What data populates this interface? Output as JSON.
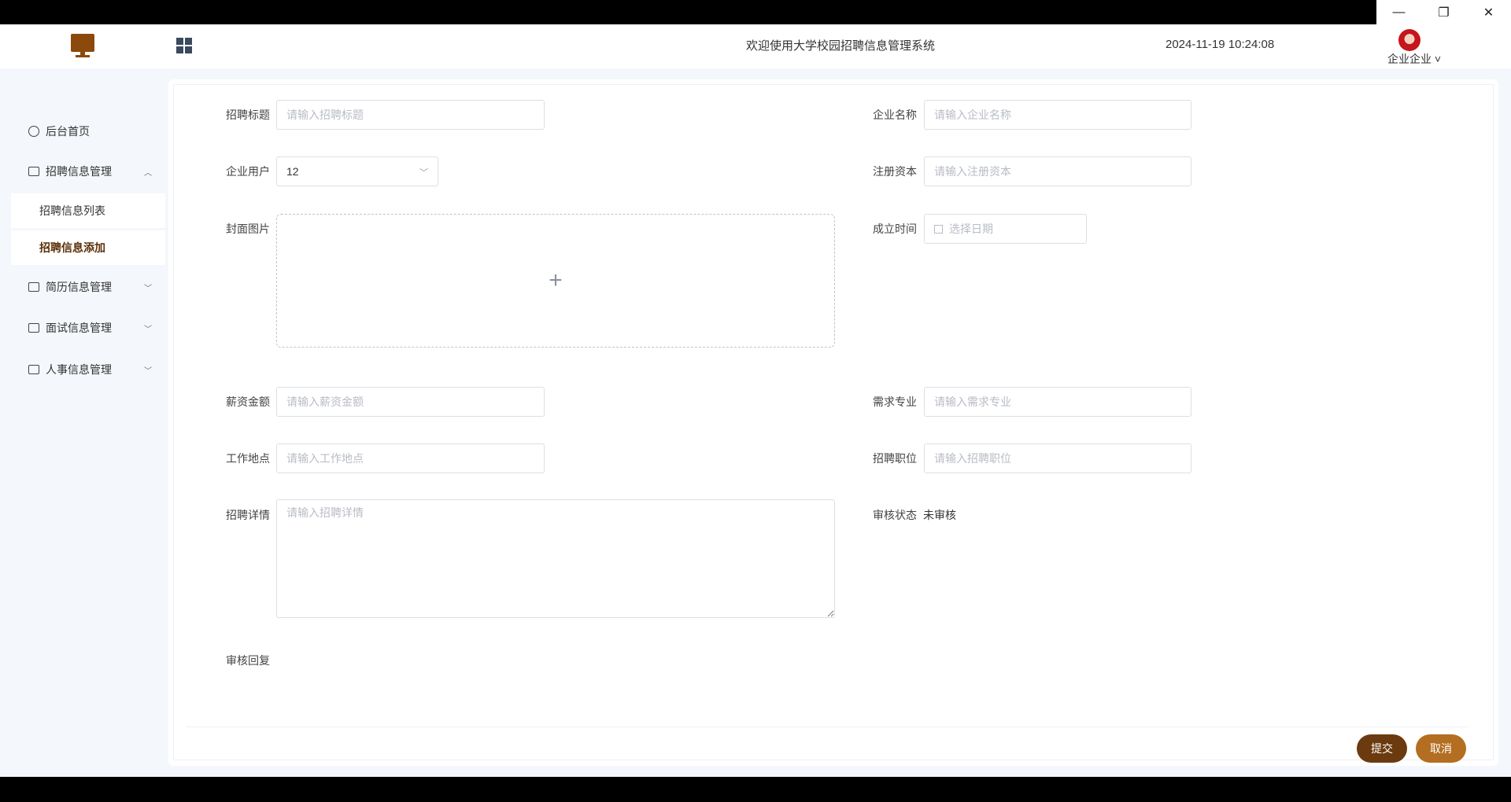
{
  "window": {
    "minimize": "—",
    "restore": "❐",
    "close": "✕"
  },
  "header": {
    "title": "欢迎使用大学校园招聘信息管理系统",
    "datetime": "2024-11-19 10:24:08",
    "user": "企业企业"
  },
  "sidebar": {
    "items": [
      {
        "label": "后台首页",
        "icon": "power-icon"
      },
      {
        "label": "招聘信息管理",
        "icon": "table-icon",
        "chevron": "︿"
      },
      {
        "label": "简历信息管理",
        "icon": "table-icon",
        "chevron": "﹀"
      },
      {
        "label": "面试信息管理",
        "icon": "table-icon",
        "chevron": "﹀"
      },
      {
        "label": "人事信息管理",
        "icon": "table-icon",
        "chevron": "﹀"
      }
    ],
    "sub_items": [
      {
        "label": "招聘信息列表"
      },
      {
        "label": "招聘信息添加"
      }
    ]
  },
  "form": {
    "title_label": "招聘标题",
    "title_placeholder": "请输入招聘标题",
    "company_label": "企业名称",
    "company_placeholder": "请输入企业名称",
    "user_label": "企业用户",
    "user_value": "12",
    "capital_label": "注册资本",
    "capital_placeholder": "请输入注册资本",
    "cover_label": "封面图片",
    "upload_plus": "+",
    "founded_label": "成立时间",
    "founded_placeholder": "选择日期",
    "salary_label": "薪资金额",
    "salary_placeholder": "请输入薪资金额",
    "major_label": "需求专业",
    "major_placeholder": "请输入需求专业",
    "location_label": "工作地点",
    "location_placeholder": "请输入工作地点",
    "position_label": "招聘职位",
    "position_placeholder": "请输入招聘职位",
    "detail_label": "招聘详情",
    "detail_placeholder": "请输入招聘详情",
    "status_label": "审核状态",
    "status_value": "未审核",
    "reply_label": "审核回复"
  },
  "actions": {
    "submit": "提交",
    "cancel": "取消"
  },
  "colors": {
    "brand_dark": "#6b3a0e",
    "brand_light": "#b36e21"
  }
}
